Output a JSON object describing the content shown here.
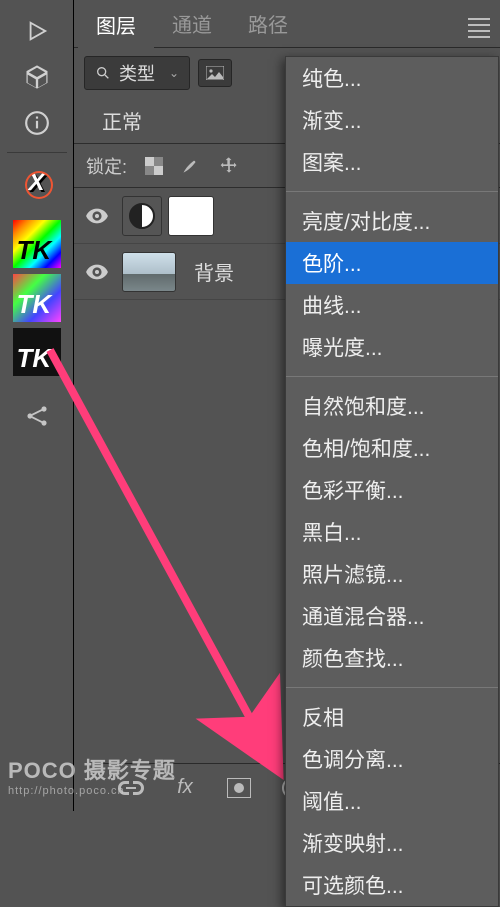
{
  "tabs": {
    "layers": "图层",
    "channels": "通道",
    "paths": "路径"
  },
  "filter": {
    "type_label": "类型"
  },
  "blend": {
    "mode": "正常"
  },
  "lock": {
    "label": "锁定:"
  },
  "layers_list": {
    "bg_name": "背景"
  },
  "icons": {
    "play": "play-icon",
    "cube": "cube-icon",
    "info": "info-icon",
    "x": "X",
    "tk": "TK",
    "share": "share-icon",
    "search": "search",
    "img": "img-icon",
    "chev": "⌄",
    "eye": "eye-icon",
    "pixel": "pixel-icon",
    "brush": "brush-icon",
    "move": "move-icon",
    "lock": "lock-icon",
    "link": "link-icon",
    "fx": "fx",
    "mask": "mask-icon",
    "adjust": "adjust-icon",
    "folder": "folder-icon",
    "newlayer": "new-layer-icon",
    "trash": "trash-icon",
    "hamburger": "menu"
  },
  "menu": {
    "items": [
      "纯色...",
      "渐变...",
      "图案...",
      "---",
      "亮度/对比度...",
      "色阶...",
      "曲线...",
      "曝光度...",
      "---",
      "自然饱和度...",
      "色相/饱和度...",
      "色彩平衡...",
      "黑白...",
      "照片滤镜...",
      "通道混合器...",
      "颜色查找...",
      "---",
      "反相",
      "色调分离...",
      "阈值...",
      "渐变映射...",
      "可选颜色..."
    ],
    "selected_index": 5
  },
  "watermark": {
    "brand": "POCO 摄影专题",
    "url": "http://photo.poco.cn"
  }
}
